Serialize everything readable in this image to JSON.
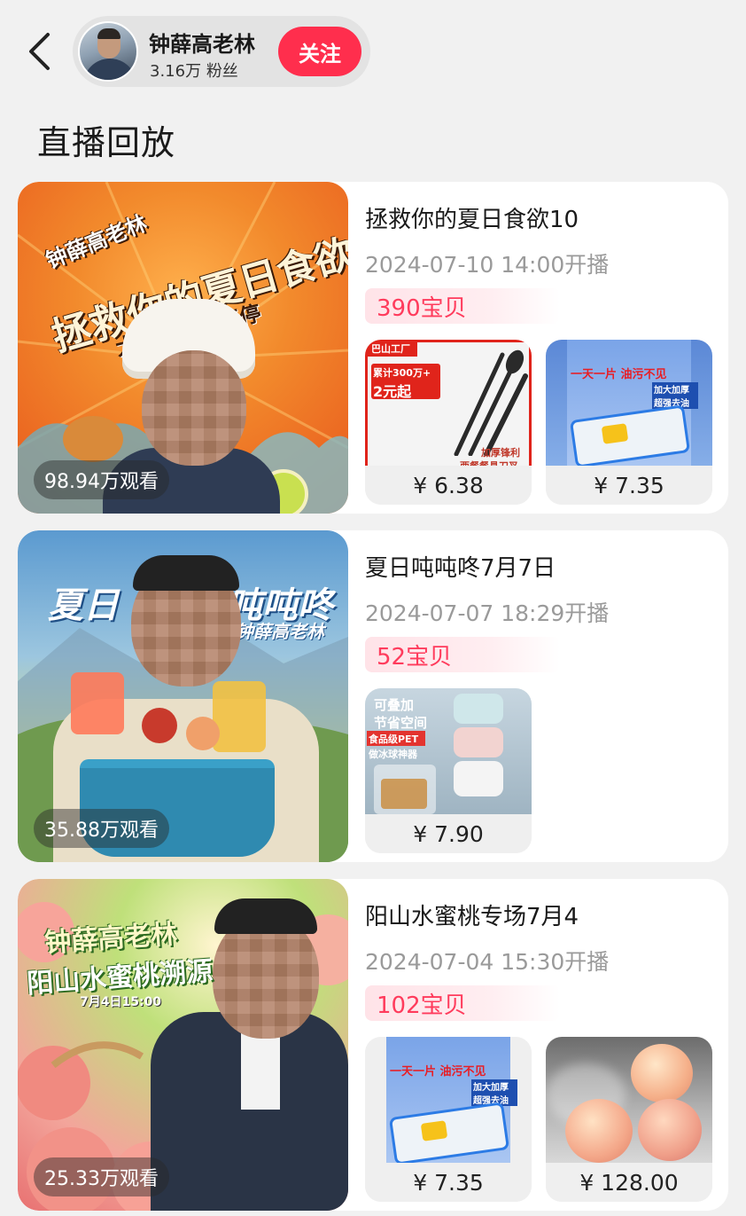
{
  "header": {
    "user_name": "钟薛高老林",
    "fans_count": "3.16万",
    "fans_label": "粉丝",
    "follow_label": "关注"
  },
  "section_title": "直播回放",
  "colors": {
    "accent": "#ff2e4d",
    "badge_text": "#ff3b5c",
    "background": "#f1f1f1"
  },
  "lives": [
    {
      "title": "拯救你的夏日食欲10",
      "time": "2024-07-10 14:00开播",
      "goods_count": "390宝贝",
      "views": "98.94万观看",
      "cover_brand": "钟薛高老林",
      "cover_headline": "拯救你的夏日食欲",
      "cover_subline": "大额红包返不停",
      "products": [
        {
          "price": "¥ 6.38",
          "tag": "巴山工厂",
          "badge": "累计300万+",
          "price_tag": "2元起",
          "label1": "加厚锋利",
          "label2": "西餐餐具刀叉"
        },
        {
          "price": "¥ 7.35",
          "headline": "一天一片 油污不见",
          "label1": "加大加厚",
          "label2": "超强去油"
        }
      ]
    },
    {
      "title": "夏日吨吨咚7月7日",
      "time": "2024-07-07 18:29开播",
      "goods_count": "52宝贝",
      "views": "35.88万观看",
      "cover_headline_left": "夏日",
      "cover_headline_right": "吨吨咚",
      "cover_brand": "钟薛高老林",
      "products": [
        {
          "price": "¥ 7.90",
          "line1": "可叠加",
          "line2": "节省空间",
          "line3": "食品级PET",
          "line4": "做冰球神器"
        }
      ]
    },
    {
      "title": "阳山水蜜桃专场7月4",
      "time": "2024-07-04 15:30开播",
      "goods_count": "102宝贝",
      "views": "25.33万观看",
      "cover_brand": "钟薛高老林",
      "cover_headline": "阳山水蜜桃溯源",
      "cover_date": "7月4日15:00",
      "products": [
        {
          "price": "¥ 7.35",
          "headline": "一天一片 油污不见",
          "label1": "加大加厚",
          "label2": "超强去油"
        },
        {
          "price": "¥ 128.00"
        }
      ]
    }
  ]
}
